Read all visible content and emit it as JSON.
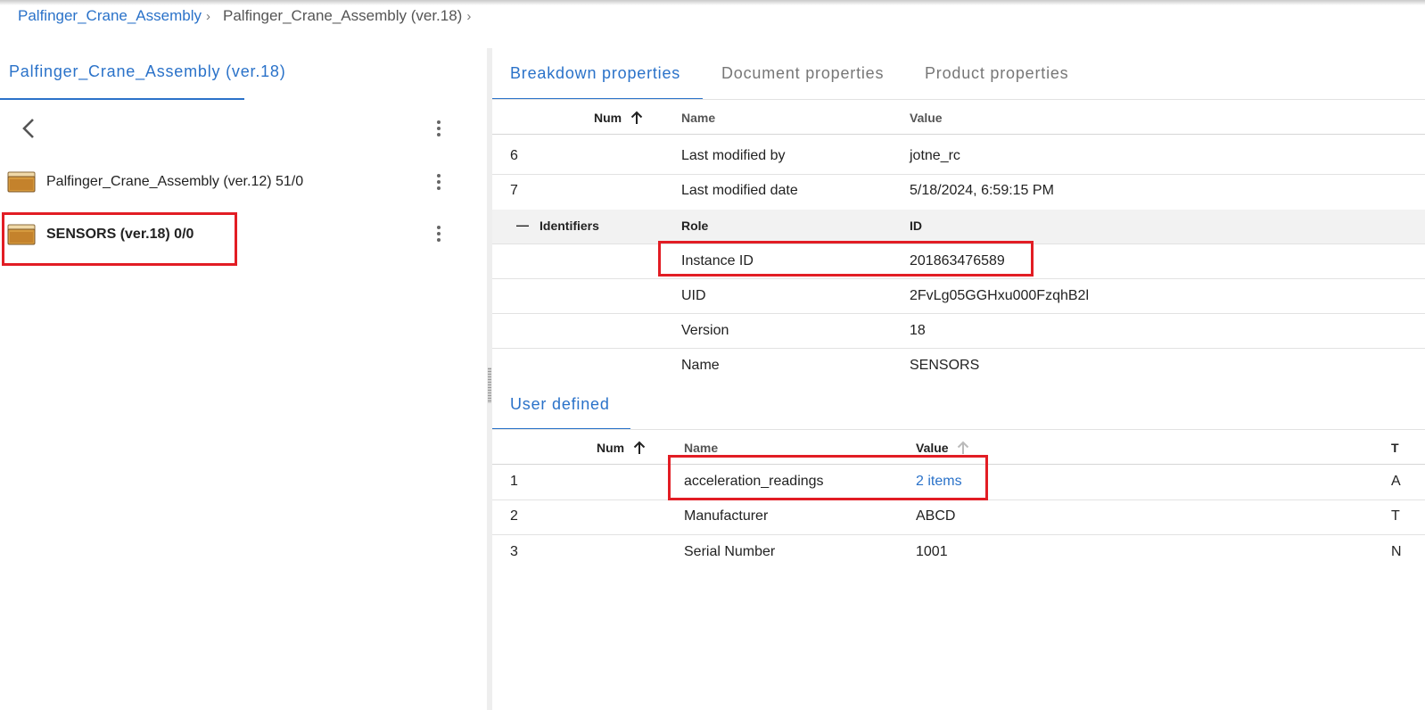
{
  "breadcrumb": {
    "root": "Palfinger_Crane_Assembly",
    "current": "Palfinger_Crane_Assembly (ver.18)",
    "separator": "›"
  },
  "left_panel": {
    "tab_label": "Palfinger_Crane_Assembly (ver.18)",
    "items": [
      {
        "label": "Palfinger_Crane_Assembly (ver.12) 51/0",
        "icon": "folder-box-icon"
      },
      {
        "label": "SENSORS (ver.18) 0/0",
        "icon": "folder-box-icon",
        "selected": true
      }
    ]
  },
  "tabs": [
    {
      "label": "Breakdown properties",
      "active": true
    },
    {
      "label": "Document properties",
      "active": false
    },
    {
      "label": "Product properties",
      "active": false
    }
  ],
  "breakdown": {
    "headers": {
      "num": "Num",
      "name": "Name",
      "value": "Value"
    },
    "rows": [
      {
        "num": "6",
        "name": "Last modified by",
        "value": "jotne_rc"
      },
      {
        "num": "7",
        "name": "Last modified date",
        "value": "5/18/2024, 6:59:15 PM"
      }
    ],
    "identifiers": {
      "toggle": "—",
      "label": "Identifiers",
      "role_header": "Role",
      "id_header": "ID",
      "rows": [
        {
          "role": "Instance ID",
          "id": "201863476589"
        },
        {
          "role": "UID",
          "id": "2FvLg05GGHxu000FzqhB2l"
        },
        {
          "role": "Version",
          "id": "18"
        },
        {
          "role": "Name",
          "id": "SENSORS"
        }
      ]
    }
  },
  "user_defined": {
    "tab_label": "User defined",
    "headers": {
      "num": "Num",
      "name": "Name",
      "value": "Value",
      "type_partial": "T"
    },
    "rows": [
      {
        "num": "1",
        "name": "acceleration_readings",
        "value": "2 items",
        "value_is_link": true,
        "type_partial": "A"
      },
      {
        "num": "2",
        "name": "Manufacturer",
        "value": "ABCD",
        "type_partial": "T"
      },
      {
        "num": "3",
        "name": "Serial Number",
        "value": "1001",
        "type_partial": "N"
      }
    ]
  },
  "colors": {
    "accent": "#2a72c9",
    "highlight": "#e21d24",
    "group_bg": "#f2f2f2"
  }
}
